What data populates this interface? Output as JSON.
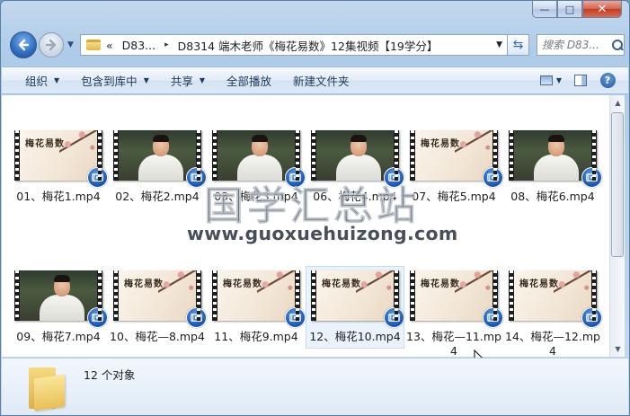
{
  "window": {
    "caption": {
      "minimize": "—",
      "maximize": "□",
      "close": "✕"
    }
  },
  "nav": {
    "breadcrumb": {
      "overflow": "«",
      "parent": "D83...",
      "separator": "▸",
      "current": "D8314 端木老师《梅花易数》12集视频【19学分】"
    },
    "search_placeholder": "搜索 D83..."
  },
  "toolbar": {
    "organize": "组织",
    "include_in_library": "包含到库中",
    "share": "共享",
    "play_all": "全部播放",
    "new_folder": "新建文件夹"
  },
  "files": [
    {
      "name": "01、梅花1.mp4",
      "thumb": "slide",
      "slide_title": "梅花易数"
    },
    {
      "name": "02、梅花2.mp4",
      "thumb": "person"
    },
    {
      "name": "03、梅花3.mp4",
      "thumb": "person"
    },
    {
      "name": "06、梅花4.mp4",
      "thumb": "person"
    },
    {
      "name": "07、梅花5.mp4",
      "thumb": "slide",
      "slide_title": "梅花易数"
    },
    {
      "name": "08、梅花6.mp4",
      "thumb": "person"
    },
    {
      "name": "09、梅花7.mp4",
      "thumb": "person"
    },
    {
      "name": "10、梅花—8.mp4",
      "thumb": "slide",
      "slide_title": "梅花易数"
    },
    {
      "name": "11、梅花9.mp4",
      "thumb": "slide",
      "slide_title": "梅花易数"
    },
    {
      "name": "12、梅花10.mp4",
      "thumb": "slide",
      "slide_title": "梅花易数",
      "selected": true
    },
    {
      "name": "13、梅花—11.mp4",
      "thumb": "slide",
      "slide_title": "梅花易数"
    },
    {
      "name": "14、梅花—12.mp4",
      "thumb": "slide",
      "slide_title": "梅花易数"
    }
  ],
  "watermark": {
    "title": "国学汇总站",
    "url": "www.guoxuehuizong.com"
  },
  "details": {
    "count": "12 个对象"
  },
  "colors": {
    "accent": "#1c58b8",
    "toolbar_text": "#1e395b",
    "selection": "#eaf3fc"
  }
}
